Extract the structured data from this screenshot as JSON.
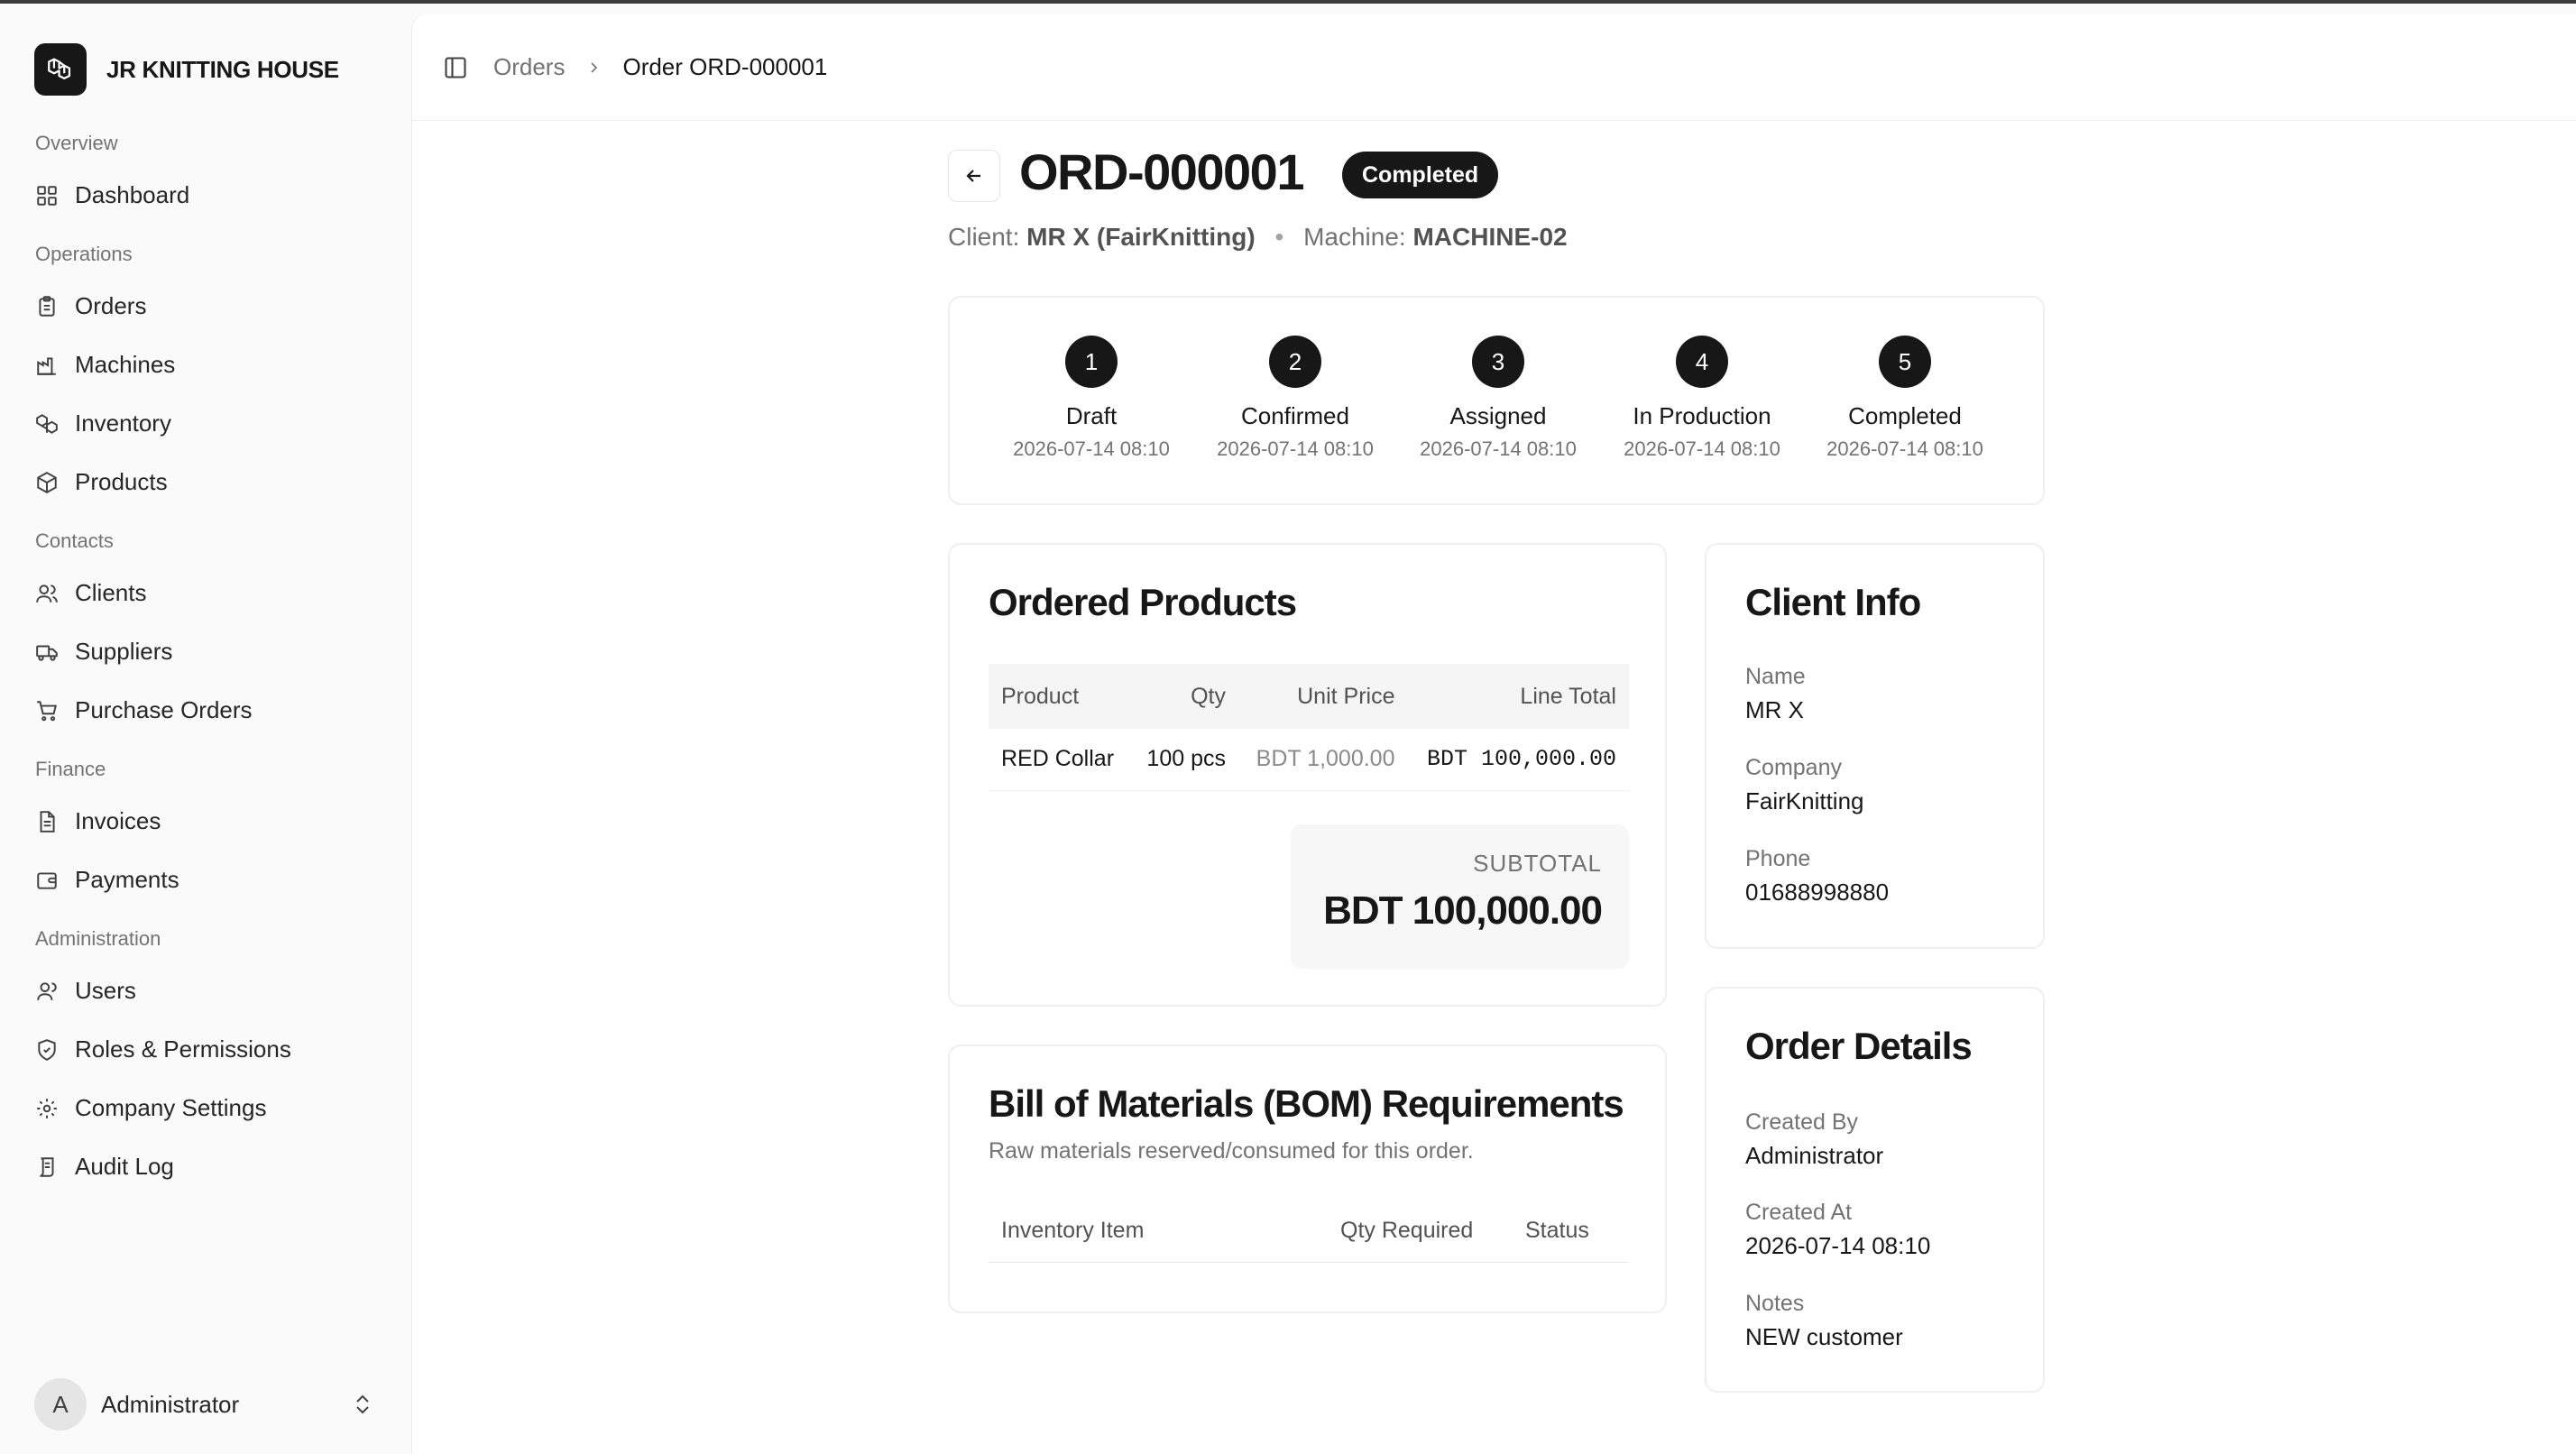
{
  "app": {
    "name": "JR KNITTING HOUSE"
  },
  "sidebar": {
    "sections": [
      {
        "label": "Overview",
        "items": [
          {
            "label": "Dashboard",
            "icon": "dashboard-icon"
          }
        ]
      },
      {
        "label": "Operations",
        "items": [
          {
            "label": "Orders",
            "icon": "clipboard-icon"
          },
          {
            "label": "Machines",
            "icon": "factory-icon"
          },
          {
            "label": "Inventory",
            "icon": "boxes-icon"
          },
          {
            "label": "Products",
            "icon": "package-icon"
          }
        ]
      },
      {
        "label": "Contacts",
        "items": [
          {
            "label": "Clients",
            "icon": "users-icon"
          },
          {
            "label": "Suppliers",
            "icon": "truck-icon"
          },
          {
            "label": "Purchase Orders",
            "icon": "cart-icon"
          }
        ]
      },
      {
        "label": "Finance",
        "items": [
          {
            "label": "Invoices",
            "icon": "file-text-icon"
          },
          {
            "label": "Payments",
            "icon": "wallet-icon"
          }
        ]
      },
      {
        "label": "Administration",
        "items": [
          {
            "label": "Users",
            "icon": "user-icon"
          },
          {
            "label": "Roles & Permissions",
            "icon": "shield-icon"
          },
          {
            "label": "Company Settings",
            "icon": "gear-icon"
          },
          {
            "label": "Audit Log",
            "icon": "scroll-icon"
          }
        ]
      }
    ],
    "user": {
      "initial": "A",
      "name": "Administrator"
    }
  },
  "breadcrumb": {
    "parent": "Orders",
    "current": "Order ORD-000001"
  },
  "order": {
    "number": "ORD-000001",
    "status": "Completed",
    "client_label": "Client:",
    "client": "MR X (FairKnitting)",
    "machine_label": "Machine:",
    "machine": "MACHINE-02"
  },
  "steps": [
    {
      "num": "1",
      "label": "Draft",
      "date": "2026-07-14 08:10"
    },
    {
      "num": "2",
      "label": "Confirmed",
      "date": "2026-07-14 08:10"
    },
    {
      "num": "3",
      "label": "Assigned",
      "date": "2026-07-14 08:10"
    },
    {
      "num": "4",
      "label": "In Production",
      "date": "2026-07-14 08:10"
    },
    {
      "num": "5",
      "label": "Completed",
      "date": "2026-07-14 08:10"
    }
  ],
  "products": {
    "title": "Ordered Products",
    "columns": [
      "Product",
      "Qty",
      "Unit Price",
      "Line Total"
    ],
    "rows": [
      {
        "product": "RED Collar",
        "qty": "100 pcs",
        "unit_price": "BDT 1,000.00",
        "line_total": "BDT 100,000.00"
      }
    ],
    "subtotal_label": "SUBTOTAL",
    "subtotal": "BDT 100,000.00"
  },
  "bom": {
    "title": "Bill of Materials (BOM) Requirements",
    "subtitle": "Raw materials reserved/consumed for this order.",
    "columns": [
      "Inventory Item",
      "Qty Required",
      "Status"
    ]
  },
  "client_info": {
    "title": "Client Info",
    "name_label": "Name",
    "name": "MR X",
    "company_label": "Company",
    "company": "FairKnitting",
    "phone_label": "Phone",
    "phone": "01688998880"
  },
  "order_details": {
    "title": "Order Details",
    "created_by_label": "Created By",
    "created_by": "Administrator",
    "created_at_label": "Created At",
    "created_at": "2026-07-14 08:10",
    "notes_label": "Notes",
    "notes": "NEW customer"
  }
}
